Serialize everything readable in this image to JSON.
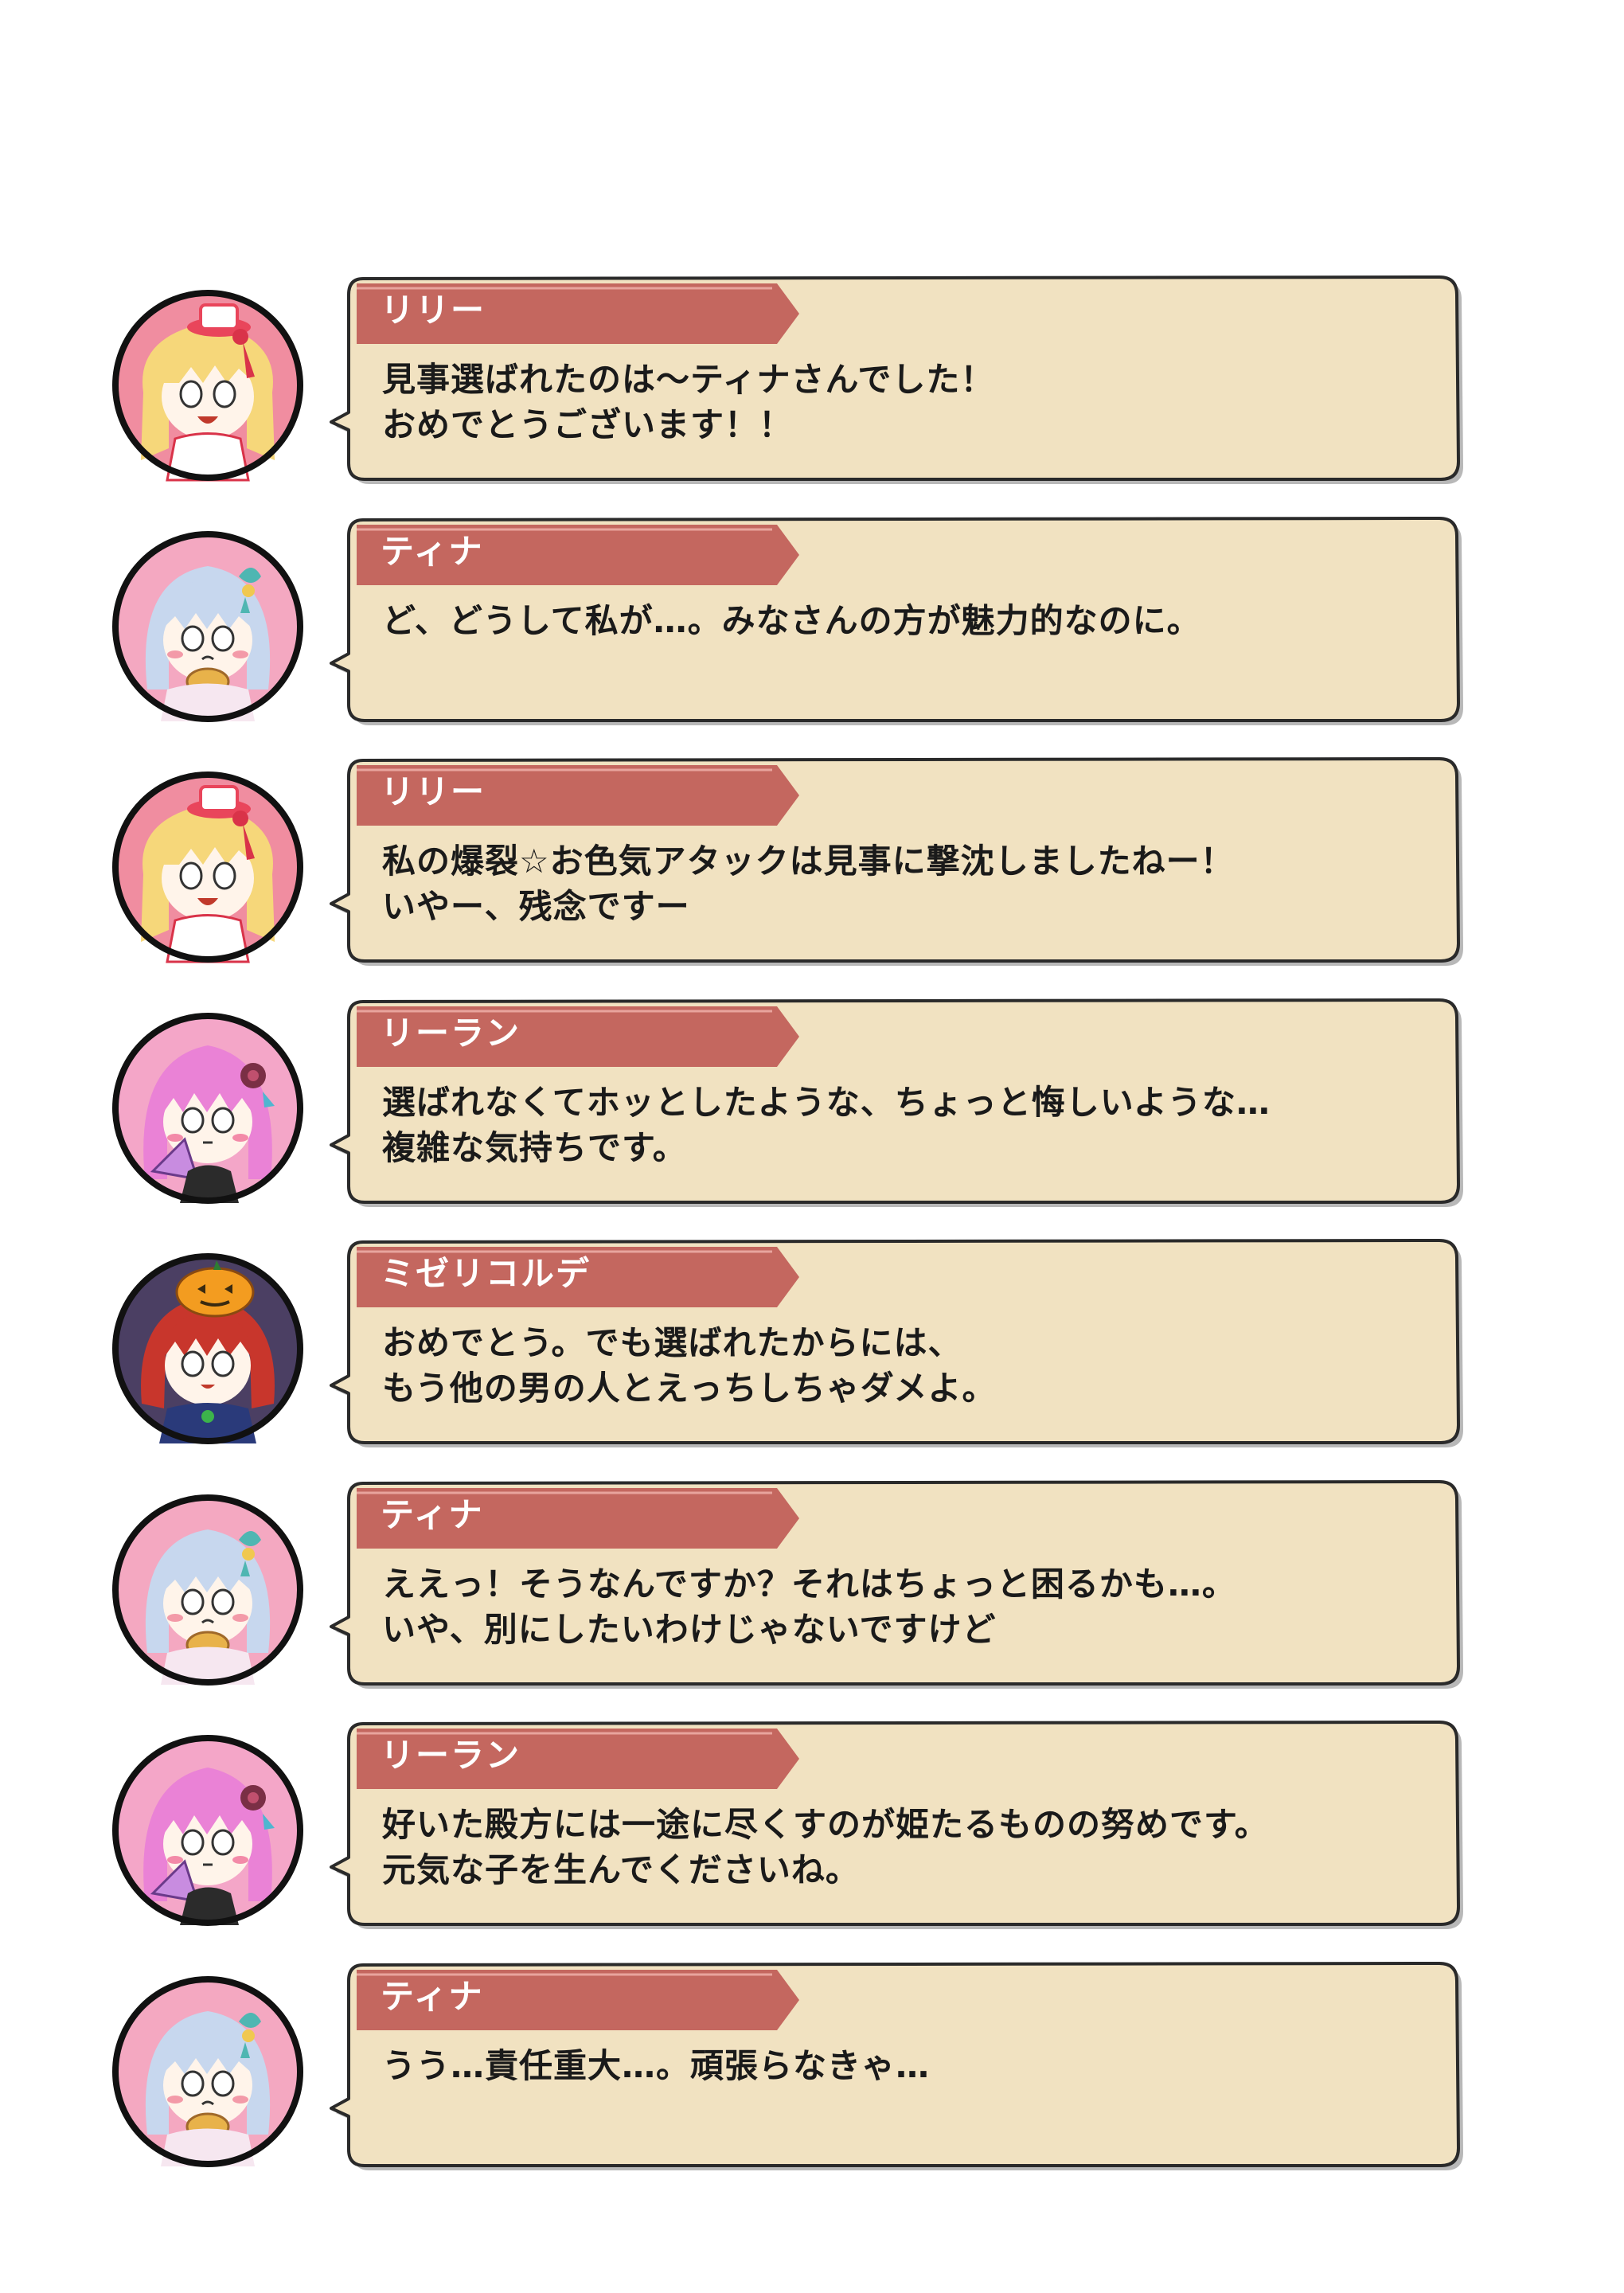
{
  "colors": {
    "bubble_fill": "#f1e2c1",
    "bubble_border": "#2a2a2a",
    "name_banner": "#c4675f",
    "name_text": "#ffffff",
    "lily_bg": "#f08da0",
    "lily_hair": "#f6d77a",
    "tina_bg": "#f4a8c1",
    "tina_hair": "#c7d7ee",
    "rilan_bg": "#f4a6c8",
    "rilan_hair": "#ea82d6",
    "miseri_bg": "#4b3f63",
    "miseri_hair": "#c8362c"
  },
  "dialogues": [
    {
      "speaker": "リリー",
      "avatar": "lily-avatar-icon",
      "lines": [
        "見事選ばれたのは～ティナさんでした！",
        "おめでとうございます！！"
      ]
    },
    {
      "speaker": "ティナ",
      "avatar": "tina-avatar-icon",
      "lines": [
        "ど、どうして私が…。みなさんの方が魅力的なのに。",
        ""
      ]
    },
    {
      "speaker": "リリー",
      "avatar": "lily-avatar-icon",
      "lines": [
        "私の爆裂☆お色気アタックは見事に撃沈しましたねー！",
        "いやー、残念ですー"
      ]
    },
    {
      "speaker": "リーラン",
      "avatar": "rilan-avatar-icon",
      "lines": [
        "選ばれなくてホッとしたような、ちょっと悔しいような…",
        "複雑な気持ちです。"
      ]
    },
    {
      "speaker": "ミゼリコルデ",
      "avatar": "miseri-avatar-icon",
      "lines": [
        "おめでとう。でも選ばれたからには、",
        "もう他の男の人とえっちしちゃダメよ。"
      ]
    },
    {
      "speaker": "ティナ",
      "avatar": "tina-avatar-icon",
      "lines": [
        "ええっ！そうなんですか？それはちょっと困るかも…。",
        "いや、別にしたいわけじゃないですけど"
      ]
    },
    {
      "speaker": "リーラン",
      "avatar": "rilan-avatar-icon",
      "lines": [
        "好いた殿方には一途に尽くすのが姫たるものの努めです。",
        "元気な子を生んでくださいね。"
      ]
    },
    {
      "speaker": "ティナ",
      "avatar": "tina-avatar-icon",
      "lines": [
        "うう…責任重大…。頑張らなきゃ…",
        ""
      ]
    }
  ]
}
